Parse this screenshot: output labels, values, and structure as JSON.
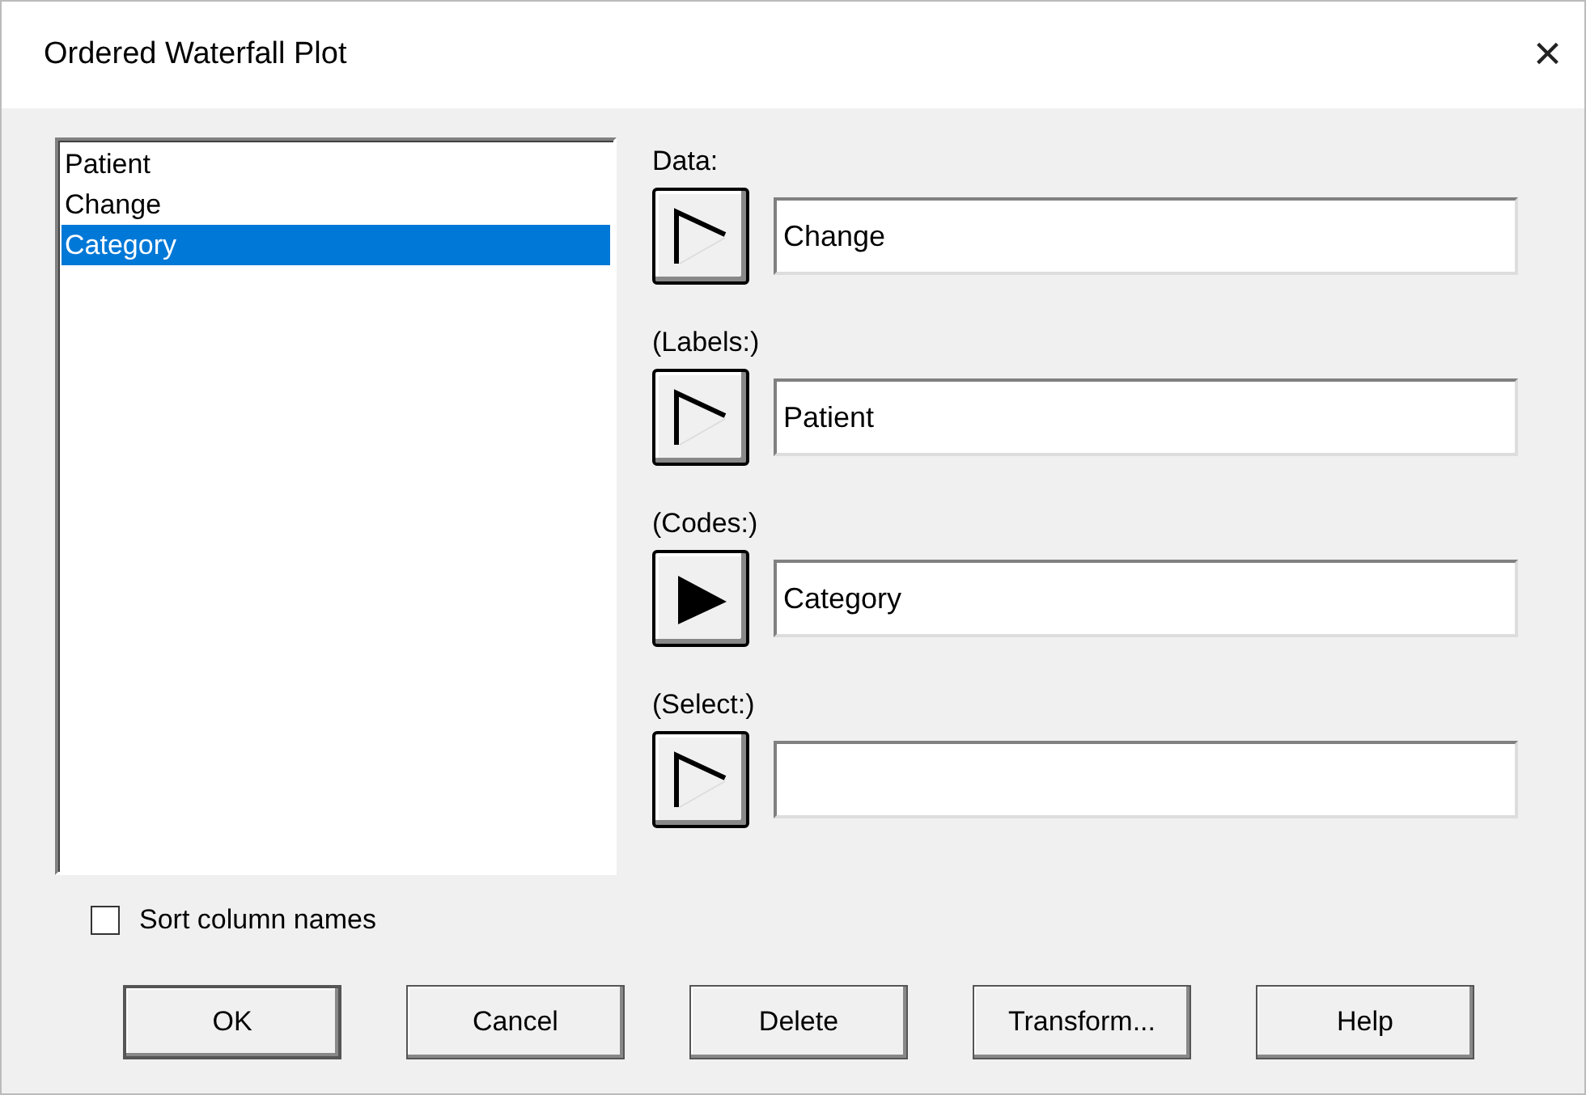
{
  "window": {
    "title": "Ordered Waterfall Plot",
    "close": "×"
  },
  "columns": [
    {
      "label": "Patient",
      "selected": false
    },
    {
      "label": "Change",
      "selected": false
    },
    {
      "label": "Category",
      "selected": true
    }
  ],
  "sort_column_names": {
    "label": "Sort column names",
    "checked": false
  },
  "fields": [
    {
      "label": "Data:",
      "value": "Change",
      "kind": "outline"
    },
    {
      "label": "(Labels:)",
      "value": "Patient",
      "kind": "outline"
    },
    {
      "label": "(Codes:)",
      "value": "Category",
      "kind": "filled"
    },
    {
      "label": "(Select:)",
      "kind": "outline"
    }
  ],
  "buttons": [
    {
      "label": "OK",
      "default": true
    },
    {
      "label": "Cancel",
      "default": false
    },
    {
      "label": "Delete",
      "default": false
    },
    {
      "label": "Transform...",
      "default": false
    },
    {
      "label": "Help",
      "default": false
    }
  ]
}
